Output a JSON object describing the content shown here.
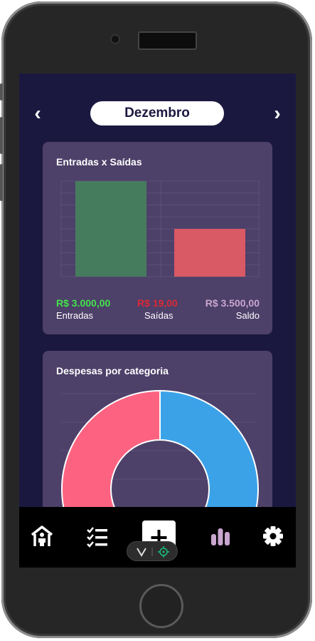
{
  "header": {
    "prev_icon": "‹",
    "month": "Dezembro",
    "next_icon": "›"
  },
  "balance_card": {
    "title": "Entradas x Saídas",
    "chart_data": {
      "type": "bar",
      "categories": [
        "Entradas",
        "Saídas"
      ],
      "values": [
        3000,
        1500
      ],
      "colors": [
        "#467c5e",
        "#d95965"
      ],
      "grid": true
    },
    "totals": [
      {
        "value": "R$ 3.000,00",
        "label": "Entradas",
        "color": "#43e34a"
      },
      {
        "value": "R$ 19,00",
        "label": "Saídas",
        "color": "#d82a35"
      },
      {
        "value": "R$ 3.500,00",
        "label": "Saldo",
        "color": "#c9a6cf"
      }
    ]
  },
  "category_card": {
    "title": "Despesas por categoria",
    "chart_data": {
      "type": "pie",
      "donut": true,
      "slices": [
        {
          "value": 50,
          "color": "#3ba2e8"
        },
        {
          "value": 50,
          "color": "#fd6381"
        }
      ]
    }
  },
  "nav": {
    "items": [
      {
        "icon": "home-person-icon"
      },
      {
        "icon": "task-list-icon"
      },
      {
        "icon": "add-icon"
      },
      {
        "icon": "bar-chart-icon",
        "color": "#c9a6cf"
      },
      {
        "icon": "gear-icon"
      }
    ]
  },
  "overlay": {
    "icon_left": "chevron-down-icon",
    "icon_right": "target-icon"
  }
}
